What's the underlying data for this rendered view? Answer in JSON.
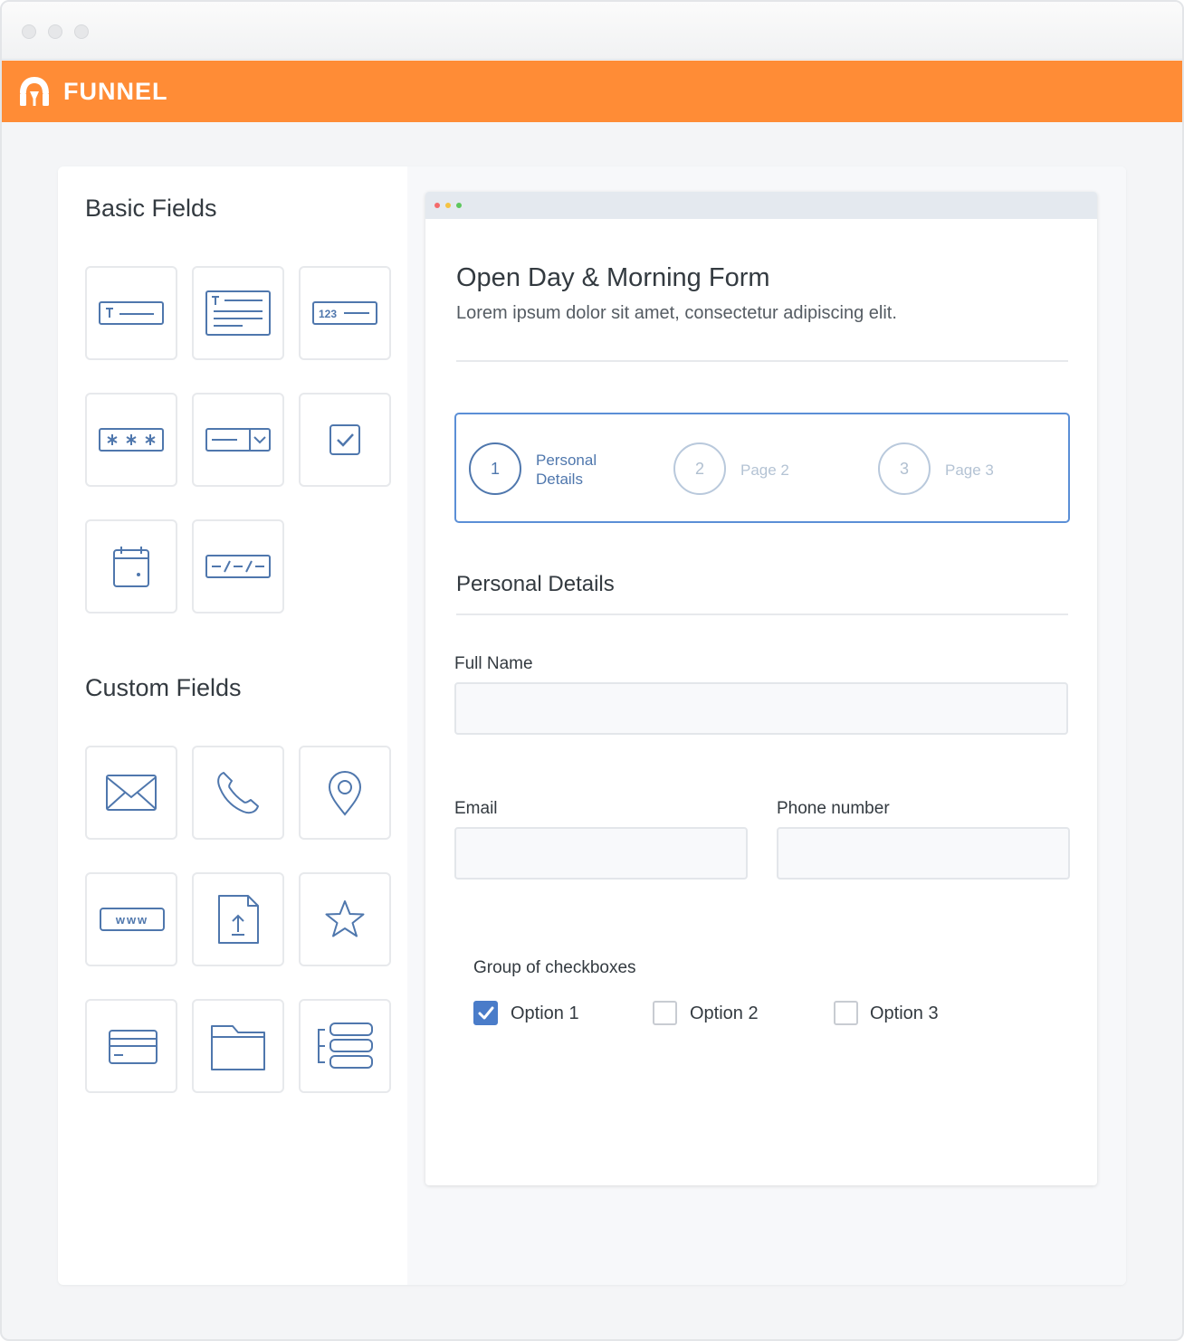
{
  "app": {
    "brand": "FUNNEL",
    "brand_color": "#ff8c36",
    "icon_color": "#4f77ad"
  },
  "sidebar": {
    "basic_title": "Basic Fields",
    "basic_fields": [
      {
        "name": "single-line-text",
        "icon": "text-field-icon"
      },
      {
        "name": "paragraph-text",
        "icon": "paragraph-icon"
      },
      {
        "name": "number",
        "icon": "number-field-icon"
      },
      {
        "name": "password",
        "icon": "password-field-icon"
      },
      {
        "name": "dropdown",
        "icon": "dropdown-field-icon"
      },
      {
        "name": "checkbox",
        "icon": "checkbox-field-icon"
      },
      {
        "name": "date",
        "icon": "calendar-icon"
      },
      {
        "name": "date-format",
        "icon": "date-format-field-icon"
      }
    ],
    "custom_title": "Custom Fields",
    "custom_fields": [
      {
        "name": "email",
        "icon": "envelope-icon"
      },
      {
        "name": "phone",
        "icon": "phone-icon"
      },
      {
        "name": "location",
        "icon": "map-pin-icon"
      },
      {
        "name": "website",
        "icon": "www-field-icon",
        "text": "www"
      },
      {
        "name": "file-upload",
        "icon": "file-upload-icon"
      },
      {
        "name": "rating",
        "icon": "star-icon"
      },
      {
        "name": "credit-card",
        "icon": "credit-card-icon"
      },
      {
        "name": "folder",
        "icon": "folder-icon"
      },
      {
        "name": "list-group",
        "icon": "list-group-icon"
      }
    ]
  },
  "form": {
    "title": "Open Day & Morning Form",
    "subtitle": "Lorem ipsum dolor sit amet, consectetur adipiscing elit.",
    "steps": [
      {
        "number": "1",
        "label": "Personal Details",
        "active": true
      },
      {
        "number": "2",
        "label": "Page 2",
        "active": false
      },
      {
        "number": "3",
        "label": "Page 3",
        "active": false
      }
    ],
    "section_title": "Personal Details",
    "fields": {
      "full_name": {
        "label": "Full Name",
        "value": ""
      },
      "email": {
        "label": "Email",
        "value": ""
      },
      "phone": {
        "label": "Phone number",
        "value": ""
      }
    },
    "checkbox_group": {
      "label": "Group of checkboxes",
      "options": [
        {
          "label": "Option 1",
          "checked": true
        },
        {
          "label": "Option 2",
          "checked": false
        },
        {
          "label": "Option 3",
          "checked": false
        }
      ]
    }
  }
}
